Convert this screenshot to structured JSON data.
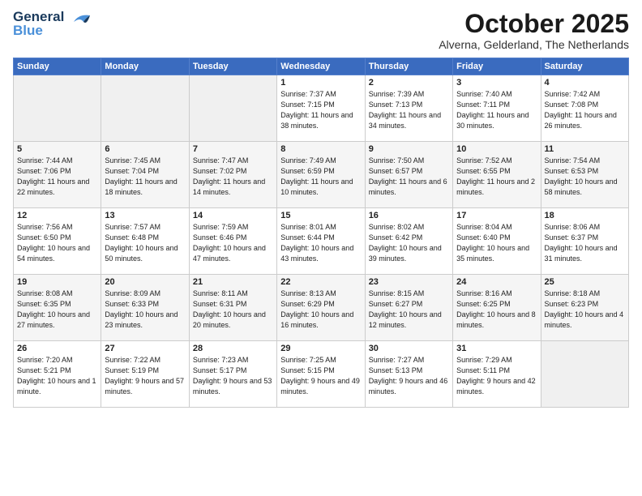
{
  "logo": {
    "text1": "General",
    "text2": "Blue"
  },
  "title": "October 2025",
  "subtitle": "Alverna, Gelderland, The Netherlands",
  "headers": [
    "Sunday",
    "Monday",
    "Tuesday",
    "Wednesday",
    "Thursday",
    "Friday",
    "Saturday"
  ],
  "weeks": [
    [
      {
        "day": "",
        "info": ""
      },
      {
        "day": "",
        "info": ""
      },
      {
        "day": "",
        "info": ""
      },
      {
        "day": "1",
        "info": "Sunrise: 7:37 AM\nSunset: 7:15 PM\nDaylight: 11 hours\nand 38 minutes."
      },
      {
        "day": "2",
        "info": "Sunrise: 7:39 AM\nSunset: 7:13 PM\nDaylight: 11 hours\nand 34 minutes."
      },
      {
        "day": "3",
        "info": "Sunrise: 7:40 AM\nSunset: 7:11 PM\nDaylight: 11 hours\nand 30 minutes."
      },
      {
        "day": "4",
        "info": "Sunrise: 7:42 AM\nSunset: 7:08 PM\nDaylight: 11 hours\nand 26 minutes."
      }
    ],
    [
      {
        "day": "5",
        "info": "Sunrise: 7:44 AM\nSunset: 7:06 PM\nDaylight: 11 hours\nand 22 minutes."
      },
      {
        "day": "6",
        "info": "Sunrise: 7:45 AM\nSunset: 7:04 PM\nDaylight: 11 hours\nand 18 minutes."
      },
      {
        "day": "7",
        "info": "Sunrise: 7:47 AM\nSunset: 7:02 PM\nDaylight: 11 hours\nand 14 minutes."
      },
      {
        "day": "8",
        "info": "Sunrise: 7:49 AM\nSunset: 6:59 PM\nDaylight: 11 hours\nand 10 minutes."
      },
      {
        "day": "9",
        "info": "Sunrise: 7:50 AM\nSunset: 6:57 PM\nDaylight: 11 hours\nand 6 minutes."
      },
      {
        "day": "10",
        "info": "Sunrise: 7:52 AM\nSunset: 6:55 PM\nDaylight: 11 hours\nand 2 minutes."
      },
      {
        "day": "11",
        "info": "Sunrise: 7:54 AM\nSunset: 6:53 PM\nDaylight: 10 hours\nand 58 minutes."
      }
    ],
    [
      {
        "day": "12",
        "info": "Sunrise: 7:56 AM\nSunset: 6:50 PM\nDaylight: 10 hours\nand 54 minutes."
      },
      {
        "day": "13",
        "info": "Sunrise: 7:57 AM\nSunset: 6:48 PM\nDaylight: 10 hours\nand 50 minutes."
      },
      {
        "day": "14",
        "info": "Sunrise: 7:59 AM\nSunset: 6:46 PM\nDaylight: 10 hours\nand 47 minutes."
      },
      {
        "day": "15",
        "info": "Sunrise: 8:01 AM\nSunset: 6:44 PM\nDaylight: 10 hours\nand 43 minutes."
      },
      {
        "day": "16",
        "info": "Sunrise: 8:02 AM\nSunset: 6:42 PM\nDaylight: 10 hours\nand 39 minutes."
      },
      {
        "day": "17",
        "info": "Sunrise: 8:04 AM\nSunset: 6:40 PM\nDaylight: 10 hours\nand 35 minutes."
      },
      {
        "day": "18",
        "info": "Sunrise: 8:06 AM\nSunset: 6:37 PM\nDaylight: 10 hours\nand 31 minutes."
      }
    ],
    [
      {
        "day": "19",
        "info": "Sunrise: 8:08 AM\nSunset: 6:35 PM\nDaylight: 10 hours\nand 27 minutes."
      },
      {
        "day": "20",
        "info": "Sunrise: 8:09 AM\nSunset: 6:33 PM\nDaylight: 10 hours\nand 23 minutes."
      },
      {
        "day": "21",
        "info": "Sunrise: 8:11 AM\nSunset: 6:31 PM\nDaylight: 10 hours\nand 20 minutes."
      },
      {
        "day": "22",
        "info": "Sunrise: 8:13 AM\nSunset: 6:29 PM\nDaylight: 10 hours\nand 16 minutes."
      },
      {
        "day": "23",
        "info": "Sunrise: 8:15 AM\nSunset: 6:27 PM\nDaylight: 10 hours\nand 12 minutes."
      },
      {
        "day": "24",
        "info": "Sunrise: 8:16 AM\nSunset: 6:25 PM\nDaylight: 10 hours\nand 8 minutes."
      },
      {
        "day": "25",
        "info": "Sunrise: 8:18 AM\nSunset: 6:23 PM\nDaylight: 10 hours\nand 4 minutes."
      }
    ],
    [
      {
        "day": "26",
        "info": "Sunrise: 7:20 AM\nSunset: 5:21 PM\nDaylight: 10 hours\nand 1 minute."
      },
      {
        "day": "27",
        "info": "Sunrise: 7:22 AM\nSunset: 5:19 PM\nDaylight: 9 hours\nand 57 minutes."
      },
      {
        "day": "28",
        "info": "Sunrise: 7:23 AM\nSunset: 5:17 PM\nDaylight: 9 hours\nand 53 minutes."
      },
      {
        "day": "29",
        "info": "Sunrise: 7:25 AM\nSunset: 5:15 PM\nDaylight: 9 hours\nand 49 minutes."
      },
      {
        "day": "30",
        "info": "Sunrise: 7:27 AM\nSunset: 5:13 PM\nDaylight: 9 hours\nand 46 minutes."
      },
      {
        "day": "31",
        "info": "Sunrise: 7:29 AM\nSunset: 5:11 PM\nDaylight: 9 hours\nand 42 minutes."
      },
      {
        "day": "",
        "info": ""
      }
    ]
  ]
}
